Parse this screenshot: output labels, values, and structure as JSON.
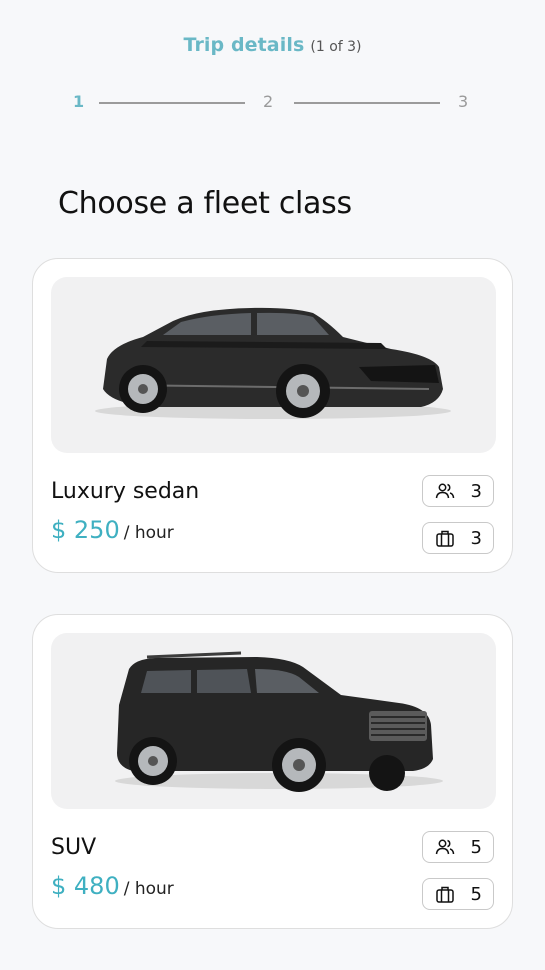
{
  "header": {
    "title": "Trip details",
    "subtitle": "(1 of 3)"
  },
  "stepper": {
    "steps": [
      "1",
      "2",
      "3"
    ],
    "active_step": 1
  },
  "section_title": "Choose a fleet class",
  "fleet": [
    {
      "name": "Luxury sedan",
      "price": "$ 250",
      "unit": "/ hour",
      "passengers": "3",
      "luggage": "3",
      "image": "black-luxury-sedan"
    },
    {
      "name": "SUV",
      "price": "$ 480",
      "unit": "/ hour",
      "passengers": "5",
      "luggage": "5",
      "image": "black-suv"
    }
  ],
  "colors": {
    "accent": "#6ab8c6",
    "price": "#3fb0c1",
    "background": "#f7f8fa"
  },
  "icons": {
    "passengers": "users-icon",
    "luggage": "luggage-icon"
  }
}
